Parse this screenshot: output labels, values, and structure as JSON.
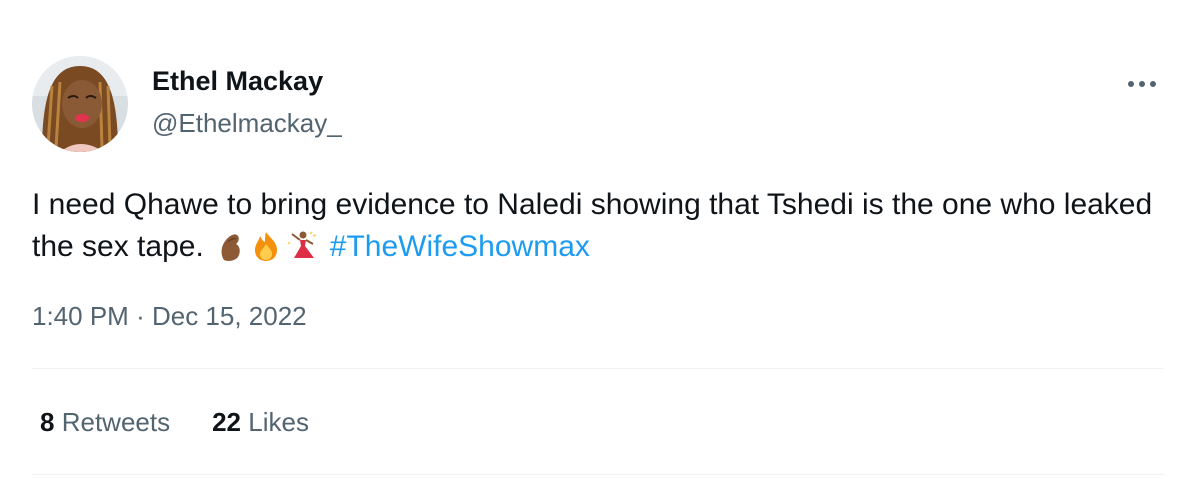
{
  "author": {
    "display_name": "Ethel Mackay",
    "username": "@Ethelmackay_"
  },
  "tweet": {
    "text": "I need Qhawe to bring evidence to Naledi showing that Tshedi is the one who leaked the sex tape.",
    "emojis": [
      "pinched-fingers-icon",
      "fire-icon",
      "woman-dancing-icon"
    ],
    "hashtag": "#TheWifeShowmax",
    "hashtag_color": "#1d9bf0",
    "time": "1:40 PM",
    "separator": "·",
    "date": "Dec 15, 2022"
  },
  "stats": {
    "retweets_count": "8",
    "retweets_label": "Retweets",
    "likes_count": "22",
    "likes_label": "Likes"
  },
  "colors": {
    "text_primary": "#0f1419",
    "text_secondary": "#536471",
    "divider": "#eff3f4"
  }
}
